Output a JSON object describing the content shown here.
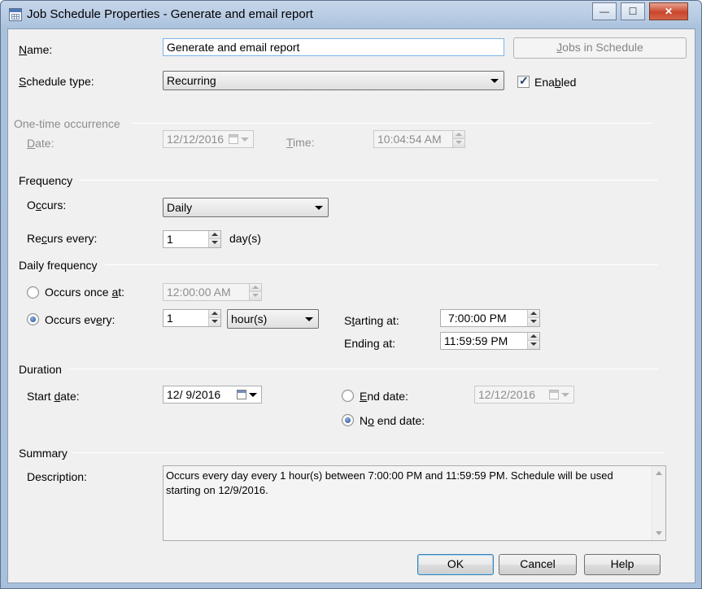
{
  "window": {
    "title": "Job Schedule Properties - Generate and email report",
    "controls": {
      "minimize": "—",
      "maximize": "☐",
      "close": "✕"
    }
  },
  "name_row": {
    "label_pre": "",
    "label_accel": "N",
    "label_post": "ame:",
    "value": "Generate and email report",
    "jobs_button": {
      "pre": "",
      "accel": "J",
      "post": "obs in Schedule"
    }
  },
  "schedule_type": {
    "label_pre": "",
    "label_accel": "S",
    "label_post": "chedule type:",
    "value": "Recurring",
    "enabled": {
      "pre": "Ena",
      "accel": "b",
      "post": "led",
      "checked": true
    }
  },
  "one_time": {
    "group": "One-time occurrence",
    "date_label": {
      "pre": "",
      "accel": "D",
      "post": "ate:"
    },
    "date_value": "12/12/2016",
    "time_label": {
      "pre": "",
      "accel": "T",
      "post": "ime:"
    },
    "time_value": "10:04:54 AM"
  },
  "frequency": {
    "group": "Frequency",
    "occurs_label": {
      "pre": "O",
      "accel": "c",
      "post": "curs:"
    },
    "occurs_value": "Daily",
    "recurs_label": {
      "pre": "Re",
      "accel": "c",
      "post": "urs every:"
    },
    "recurs_value": "1",
    "recurs_unit": "day(s)"
  },
  "daily_frequency": {
    "group": "Daily frequency",
    "once_label": {
      "pre": "Occurs once ",
      "accel": "a",
      "post": "t:"
    },
    "once_value": "12:00:00 AM",
    "every_label": {
      "pre": "Occurs ev",
      "accel": "e",
      "post": "ry:"
    },
    "every_value": "1",
    "every_unit": "hour(s)",
    "starting_label": {
      "pre": "S",
      "accel": "t",
      "post": "arting at:"
    },
    "starting_value": "7:00:00 PM",
    "ending_label": {
      "pre": "Endin",
      "accel": "g",
      "post": " at:"
    },
    "ending_value": "11:59:59 PM"
  },
  "duration": {
    "group": "Duration",
    "start_label": {
      "pre": "Start ",
      "accel": "d",
      "post": "ate:"
    },
    "start_value": "12/  9/2016",
    "end_label": {
      "pre": "",
      "accel": "E",
      "post": "nd date:"
    },
    "end_value": "12/12/2016",
    "noend_label": {
      "pre": "N",
      "accel": "o",
      "post": " end date:"
    }
  },
  "summary": {
    "group": "Summary",
    "description_label": "Description:",
    "description": "Occurs every day every 1 hour(s) between 7:00:00 PM and 11:59:59 PM. Schedule will be used starting on 12/9/2016."
  },
  "buttons": {
    "ok": "OK",
    "cancel": "Cancel",
    "help": "Help"
  }
}
